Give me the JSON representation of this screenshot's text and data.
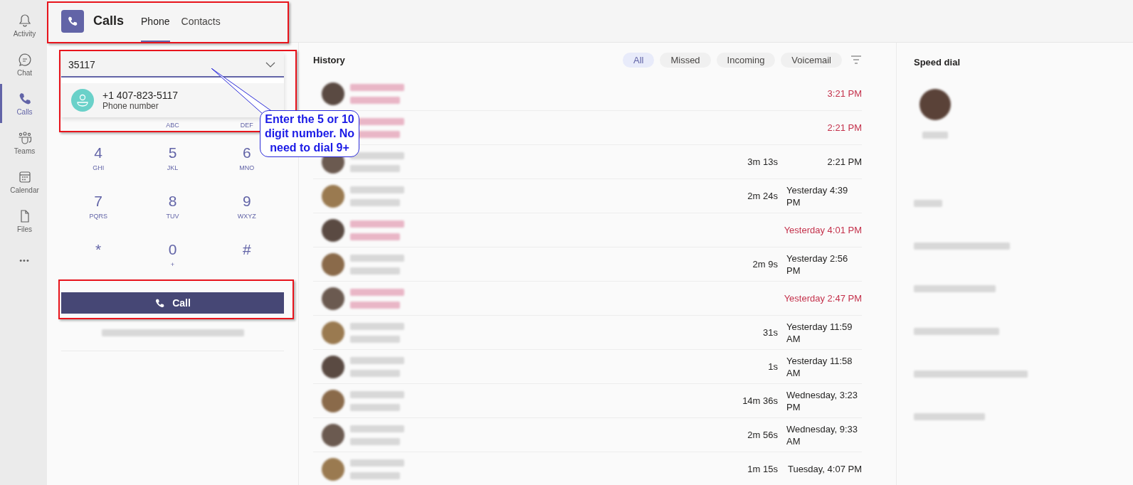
{
  "rail": [
    {
      "label": "Activity",
      "selected": false
    },
    {
      "label": "Chat",
      "selected": false
    },
    {
      "label": "Calls",
      "selected": true
    },
    {
      "label": "Teams",
      "selected": false
    },
    {
      "label": "Calendar",
      "selected": false
    },
    {
      "label": "Files",
      "selected": false
    },
    {
      "label": "•••",
      "selected": false
    }
  ],
  "header": {
    "title": "Calls",
    "tabs": [
      {
        "label": "Phone",
        "selected": true
      },
      {
        "label": "Contacts",
        "selected": false
      }
    ]
  },
  "dialer": {
    "value": "35117",
    "suggestion": {
      "number": "+1 407-823-5117",
      "type": "Phone number"
    },
    "partial_row": [
      "ABC",
      "DEF"
    ],
    "keys": [
      {
        "digit": "4",
        "letters": "GHI"
      },
      {
        "digit": "5",
        "letters": "JKL"
      },
      {
        "digit": "6",
        "letters": "MNO"
      },
      {
        "digit": "7",
        "letters": "PQRS"
      },
      {
        "digit": "8",
        "letters": "TUV"
      },
      {
        "digit": "9",
        "letters": "WXYZ"
      },
      {
        "digit": "*"
      },
      {
        "digit": "0",
        "letters": "+"
      },
      {
        "digit": "#"
      }
    ],
    "call_button": "Call"
  },
  "history": {
    "title": "History",
    "filters": [
      {
        "label": "All",
        "selected": true
      },
      {
        "label": "Missed",
        "selected": false
      },
      {
        "label": "Incoming",
        "selected": false
      },
      {
        "label": "Voicemail",
        "selected": false
      }
    ],
    "rows": [
      {
        "missed": true,
        "time": "3:21 PM"
      },
      {
        "missed": true,
        "time": "2:21 PM"
      },
      {
        "missed": false,
        "duration": "3m 13s",
        "time": "2:21 PM"
      },
      {
        "missed": false,
        "duration": "2m 24s",
        "time": "Yesterday 4:39 PM"
      },
      {
        "missed": true,
        "time": "Yesterday 4:01 PM"
      },
      {
        "missed": false,
        "duration": "2m 9s",
        "time": "Yesterday 2:56 PM"
      },
      {
        "missed": true,
        "time": "Yesterday 2:47 PM"
      },
      {
        "missed": false,
        "duration": "31s",
        "time": "Yesterday 11:59 AM"
      },
      {
        "missed": false,
        "duration": "1s",
        "time": "Yesterday 11:58 AM"
      },
      {
        "missed": false,
        "duration": "14m 36s",
        "time": "Wednesday, 3:23 PM"
      },
      {
        "missed": false,
        "duration": "2m 56s",
        "time": "Wednesday, 9:33 AM"
      },
      {
        "missed": false,
        "duration": "1m 15s",
        "time": "Tuesday, 4:07 PM"
      }
    ]
  },
  "speed_dial": {
    "title": "Speed dial"
  },
  "annotation": {
    "callout": "Enter the 5 or 10 digit number. No need to dial 9+"
  }
}
